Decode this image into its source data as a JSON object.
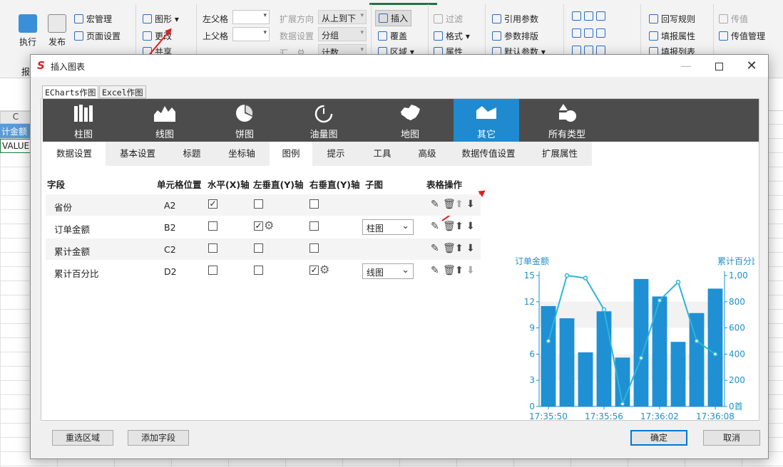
{
  "ribbon": {
    "execute_label": "执行",
    "publish_label": "发布",
    "macro_label": "宏管理",
    "page_setup_label": "页面设置",
    "graph_label": "图形",
    "change_label": "更改",
    "share_label": "共享",
    "left_parent_label": "左父格",
    "top_parent_label": "上父格",
    "expand_dir_label": "扩展方向",
    "expand_dir_value": "从上到下",
    "data_setting_label": "数据设置",
    "data_setting_value": "分组",
    "summary_label": "汇　总",
    "summary_value": "计数",
    "insert_label": "插入",
    "cover_label": "覆盖",
    "region_label": "区域",
    "filter_label": "过滤",
    "format_label": "格式",
    "attr_label": "属性",
    "ref_param_label": "引用参数",
    "param_layout_label": "参数排版",
    "default_param_label": "默认参数",
    "writeback_label": "回写规则",
    "fill_attr_label": "填报属性",
    "fill_list_label": "填报列表",
    "pass_value_label": "传值",
    "pass_value_mgmt_label": "传值管理",
    "report_group_label": "报"
  },
  "sheet": {
    "col_c": "C",
    "cell_c1": "计金额",
    "cell_c2": "VALUE!"
  },
  "dialog": {
    "title": "插入图表",
    "logo": "S",
    "outer_tabs": [
      "ECharts作图",
      "Excel作图"
    ],
    "chart_types": [
      "柱图",
      "线图",
      "饼图",
      "油量图",
      "地图",
      "其它",
      "所有类型"
    ],
    "sub_tabs": [
      "数据设置",
      "基本设置",
      "标题",
      "坐标轴",
      "图例",
      "提示",
      "工具",
      "高级",
      "数据传值设置",
      "扩展属性"
    ],
    "grid_headers": [
      "字段",
      "单元格位置",
      "水平(X)轴",
      "左垂直(Y)轴",
      "右垂直(Y)轴",
      "子图",
      "表格操作"
    ],
    "rows": [
      {
        "field": "省份",
        "cell": "A2",
        "x": "✓",
        "ly": "",
        "ry": "",
        "sub": ""
      },
      {
        "field": "订单金额",
        "cell": "B2",
        "x": "",
        "ly": "✓",
        "ry": "",
        "sub": "柱图"
      },
      {
        "field": "累计金额",
        "cell": "C2",
        "x": "",
        "ly": "",
        "ry": "",
        "sub": ""
      },
      {
        "field": "累计百分比",
        "cell": "D2",
        "x": "",
        "ly": "",
        "ry": "✓",
        "sub": "线图"
      }
    ],
    "buttons": {
      "reselect": "重选区域",
      "add_field": "添加字段",
      "ok": "确定",
      "cancel": "取消"
    }
  },
  "chart_data": {
    "type": "bar",
    "left_axis_label": "订单金额",
    "right_axis_label": "累计百分比",
    "x_ticks": [
      "17:35:50",
      "17:35:56",
      "17:36:02",
      "17:36:08"
    ],
    "left_ticks": [
      "0",
      "3",
      "6",
      "9",
      "12",
      "15"
    ],
    "right_ticks": [
      "0首",
      "200",
      "400",
      "600",
      "800",
      "1,00"
    ],
    "ylim_left": [
      0,
      15
    ],
    "ylim_right": [
      0,
      1000
    ],
    "bar_values": [
      11.5,
      10.1,
      6.2,
      10.9,
      5.6,
      14.6,
      12.6,
      7.4,
      10.7,
      13.5
    ],
    "line_values": [
      500,
      1000,
      980,
      740,
      20,
      370,
      810,
      950,
      500,
      400
    ],
    "bar_color": "#1f90d3",
    "line_color": "#2bb6d8"
  }
}
